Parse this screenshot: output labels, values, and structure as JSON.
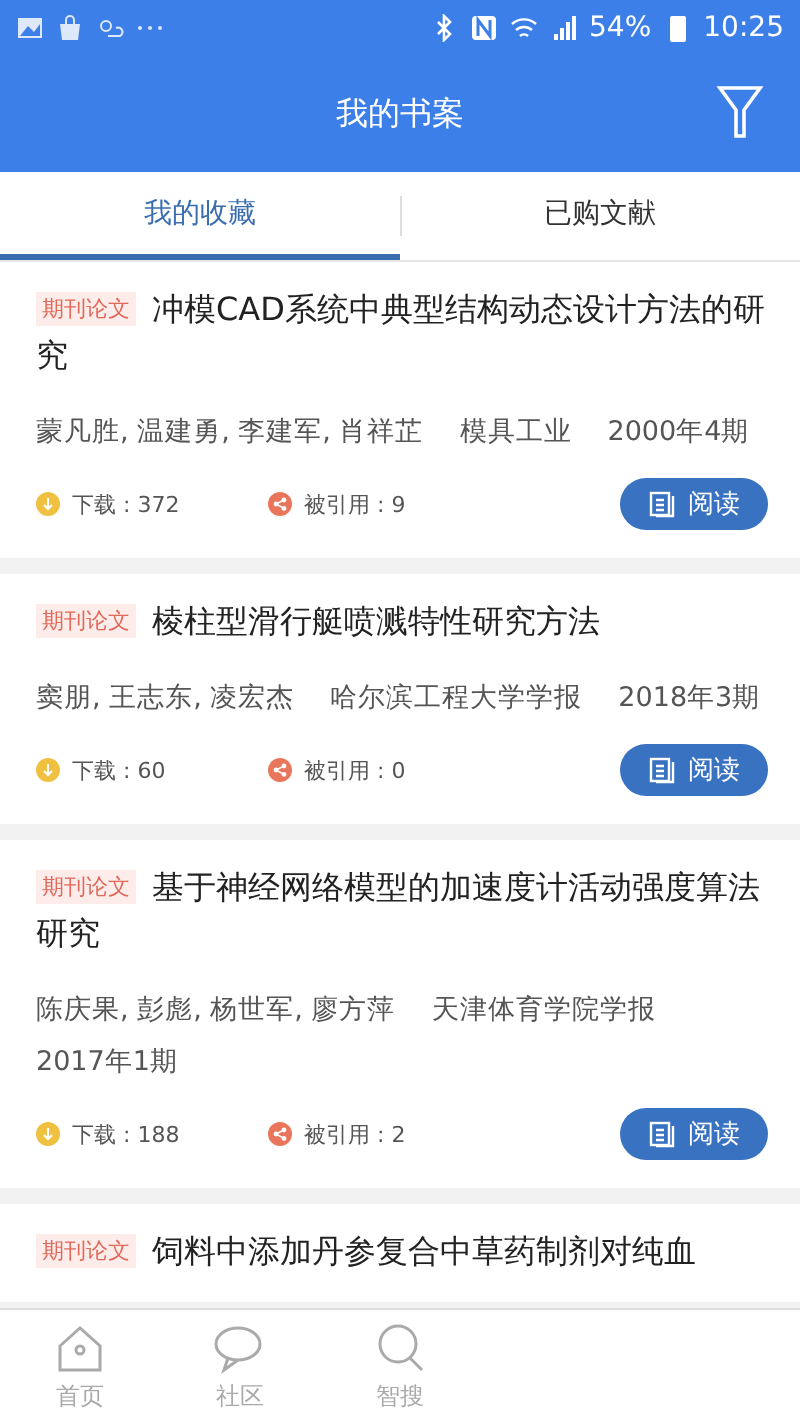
{
  "status_bar": {
    "battery": "54%",
    "time": "10:25"
  },
  "app_bar": {
    "title": "我的书案"
  },
  "tabs": [
    {
      "label": "我的收藏",
      "selected": true
    },
    {
      "label": "已购文献",
      "selected": false
    }
  ],
  "papers": [
    {
      "tag": "期刊论文",
      "title": "冲模CAD系统中典型结构动态设计方法的研究",
      "meta": [
        "蒙凡胜, 温建勇, 李建军, 肖祥芷",
        "模具工业",
        "2000年4期"
      ],
      "downloads": "下载 : 372",
      "citations": "被引用 : 9",
      "button": "阅读"
    },
    {
      "tag": "期刊论文",
      "title": "棱柱型滑行艇喷溅特性研究方法",
      "meta": [
        "窦朋, 王志东, 凌宏杰",
        "哈尔滨工程大学学报",
        "2018年3期"
      ],
      "downloads": "下载 : 60",
      "citations": "被引用 : 0",
      "button": "阅读"
    },
    {
      "tag": "期刊论文",
      "title": "基于神经网络模型的加速度计活动强度算法研究",
      "meta": [
        "陈庆果, 彭彪, 杨世军, 廖方萍",
        "天津体育学院学报",
        "2017年1期"
      ],
      "downloads": "下载 : 188",
      "citations": "被引用 : 2",
      "button": "阅读"
    },
    {
      "tag": "期刊论文",
      "title": "饲料中添加丹参复合中草药制剂对纯血"
    }
  ],
  "bottom_nav": [
    {
      "label": "首页",
      "kind": "home",
      "selected": false
    },
    {
      "label": "社区",
      "kind": "chat",
      "selected": false
    },
    {
      "label": "智搜",
      "kind": "search",
      "selected": false
    }
  ]
}
